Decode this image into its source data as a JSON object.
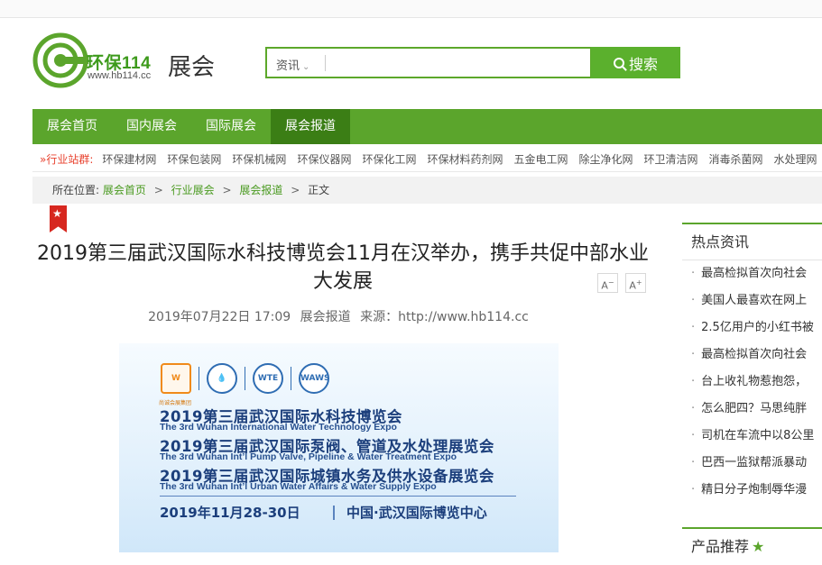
{
  "header": {
    "logo_name": "环保114",
    "logo_url": "www.hb114.cc",
    "site_label": "展会",
    "search": {
      "category": "资讯",
      "placeholder": "",
      "button_label": "搜索"
    }
  },
  "nav": {
    "items": [
      "展会首页",
      "国内展会",
      "国际展会",
      "展会报道"
    ],
    "active_index": 3
  },
  "industry": {
    "label": "»行业站群:",
    "links": [
      "环保建材网",
      "环保包装网",
      "环保机械网",
      "环保仪器网",
      "环保化工网",
      "环保材料药剂网",
      "五金电工网",
      "除尘净化网",
      "环卫清洁网",
      "消毒杀菌网",
      "水处理网"
    ]
  },
  "breadcrumb": {
    "prefix": "所在位置:",
    "items": [
      "展会首页",
      "行业展会",
      "展会报道"
    ],
    "current": "正文",
    "separator": ">"
  },
  "article": {
    "title": "2019第三届武汉国际水科技博览会11月在汉举办，携手共促中部水业大发展",
    "date": "2019年07月22日 17:09",
    "category": "展会报道",
    "source": "来源：http://www.hb114.cc",
    "font_smaller": "A",
    "font_larger": "A",
    "banner": {
      "logo_labels": [
        "W",
        "WTE",
        "WAWS"
      ],
      "logo_caption": "尚诚会展集团",
      "lines_cn": [
        "2019第三届武汉国际水科技博览会",
        "2019第三届武汉国际泵阀、管道及水处理展览会",
        "2019第三届武汉国际城镇水务及供水设备展览会"
      ],
      "lines_en": [
        "The 3rd Wuhan International Water Technology Expo",
        "The 3rd Wuhan Int’l Pump Valve, Pipeline & Water Treatment Expo",
        "The 3rd Wuhan Int’l Urban Water Affairs & Water Supply Expo"
      ],
      "date": "2019年11月28-30日",
      "venue": "中国·武汉国际博览中心"
    }
  },
  "sidebar": {
    "hot_title": "热点资讯",
    "hot_items": [
      "最高检拟首次向社会",
      "美国人最喜欢在网上",
      "2.5亿用户的小红书被",
      "最高检拟首次向社会",
      "台上收礼物惹抱怨，",
      "怎么肥四？马思纯胖",
      "司机在车流中以8公里",
      "巴西一监狱帮派暴动",
      "精日分子炮制辱华漫"
    ],
    "recommend_title": "产品推荐",
    "recommend_star": "★"
  },
  "colors": {
    "brand_green": "#5ba52c",
    "nav_active": "#3b7e15",
    "link_green": "#4a9a20",
    "bookmark_red": "#d7271f"
  }
}
